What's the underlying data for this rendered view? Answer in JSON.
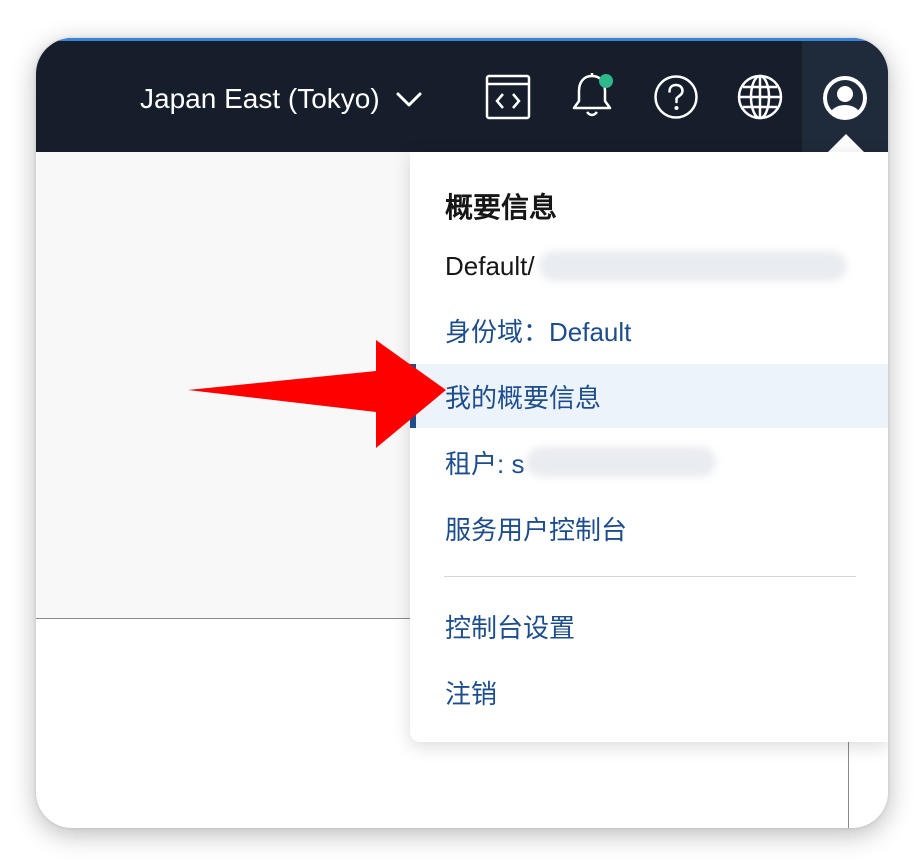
{
  "topbar": {
    "region_label": "Japan East (Tokyo)",
    "icons": {
      "region_chevron": "chevron-down-icon",
      "code_editor": "code-editor-icon",
      "notifications": "bell-icon",
      "help": "help-icon",
      "language": "globe-icon",
      "profile": "user-avatar-icon"
    },
    "notification_dot_color": "#2fb88a",
    "background_color": "#161e2b",
    "accent_color": "#3a84d6"
  },
  "profile_menu": {
    "heading": "概要信息",
    "user_prefix": "Default/",
    "identity_domain": "身份域：Default",
    "my_profile": "我的概要信息",
    "tenancy_prefix": "租户: s",
    "service_console": "服务用户控制台",
    "console_settings": "控制台设置",
    "sign_out": "注销",
    "link_color": "#1d4d8c"
  },
  "annotation": {
    "arrow_color": "#ff0000",
    "arrow_icon": "red-pointer-arrow"
  }
}
